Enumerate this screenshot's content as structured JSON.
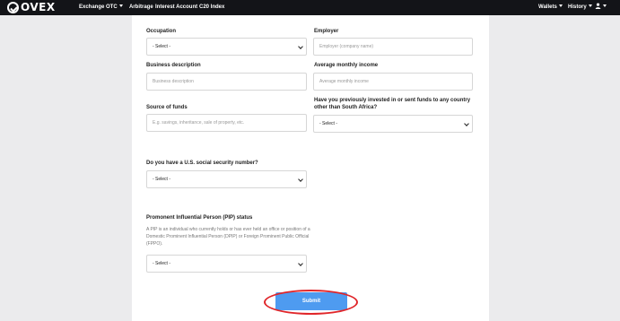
{
  "nav": {
    "logo_text": "OVEX",
    "exchange": "Exchange",
    "otc": "OTC",
    "arbitrage": "Arbitrage",
    "interest_account": "Interest Account",
    "c20_index": "C20 Index",
    "wallets": "Wallets",
    "history": "History"
  },
  "form": {
    "occupation_label": "Occupation",
    "occupation_value": "- Select -",
    "employer_label": "Employer",
    "employer_placeholder": "Employer (company name)",
    "business_label": "Business description",
    "business_placeholder": "Business description",
    "income_label": "Average monthly income",
    "income_placeholder": "Average monthly income",
    "source_label": "Source of funds",
    "source_placeholder": "E.g. savings, inheritance, sale of property, etc.",
    "invested_label": "Have you previously invested in or sent funds to any country other than South Africa?",
    "invested_value": "- Select -",
    "ssn_label": "Do you have a U.S. social security number?",
    "ssn_value": "- Select -",
    "pip_label": "Promonent Influential Person (PIP) status",
    "pip_description": "A PIP is an individual who currently holds or has ever held an office or position of a Domestic Prominent Influential Person (DPIP) or Foreign Prominent Public Official (FPPO).",
    "pip_value": "- Select -",
    "submit_label": "Submit"
  },
  "colors": {
    "navbar": "#131418",
    "submit": "#4e9bf0",
    "highlight": "#e0262a"
  }
}
